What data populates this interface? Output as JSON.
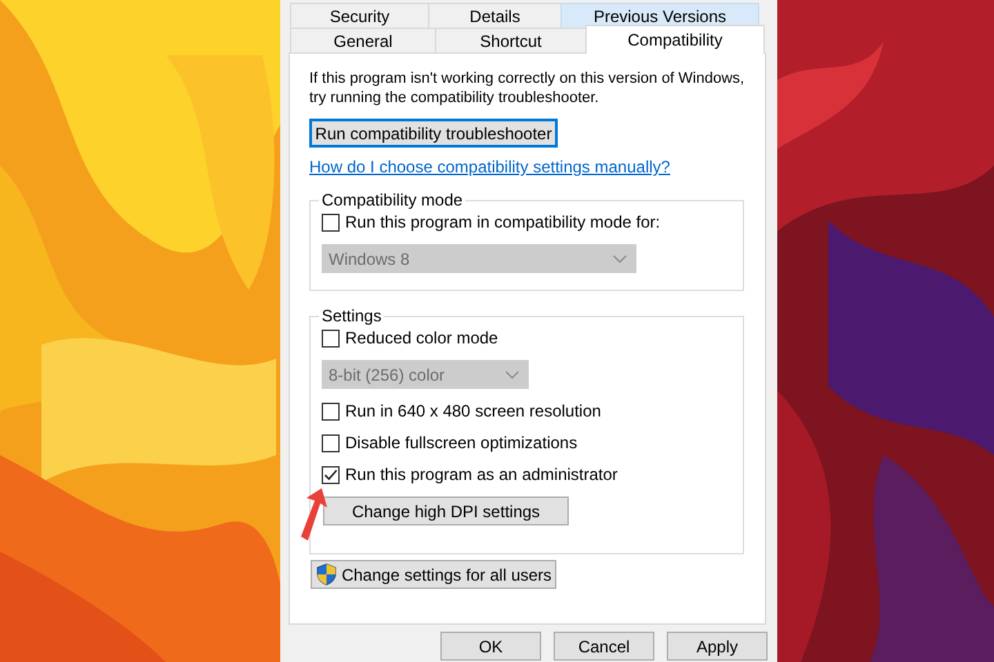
{
  "tab_rows": [
    {
      "tabs": [
        {
          "label": "Security",
          "selected": false,
          "hovered": false
        },
        {
          "label": "Details",
          "selected": false,
          "hovered": false
        },
        {
          "label": "Previous Versions",
          "selected": false,
          "hovered": true
        }
      ]
    },
    {
      "tabs": [
        {
          "label": "General",
          "selected": false,
          "hovered": false
        },
        {
          "label": "Shortcut",
          "selected": false,
          "hovered": false
        },
        {
          "label": "Compatibility",
          "selected": true,
          "hovered": false
        }
      ]
    }
  ],
  "intro": [
    "If this program isn't working correctly on this version of Windows,",
    "try running the compatibility troubleshooter."
  ],
  "troubleshoot_button": {
    "label": "Run compatibility troubleshooter",
    "focused": true
  },
  "help_link": "How do I choose compatibility settings manually?",
  "groups": [
    {
      "title": "Compatibility mode",
      "items": [
        {
          "kind": "checkbox",
          "label": "Run this program in compatibility mode for:",
          "checked": false
        },
        {
          "kind": "dropdown",
          "value": "Windows 8",
          "disabled": true
        }
      ]
    },
    {
      "title": "Settings",
      "items": [
        {
          "kind": "checkbox",
          "label": "Reduced color mode",
          "checked": false
        },
        {
          "kind": "dropdown",
          "value": "8-bit (256) color",
          "disabled": true
        },
        {
          "kind": "checkbox",
          "label": "Run in 640 x 480 screen resolution",
          "checked": false
        },
        {
          "kind": "checkbox",
          "label": "Disable fullscreen optimizations",
          "checked": false
        },
        {
          "kind": "checkbox",
          "label": "Run this program as an administrator",
          "checked": true
        },
        {
          "kind": "button",
          "label": "Change high DPI settings"
        }
      ]
    }
  ],
  "all_users_button": {
    "label": "Change settings for all users"
  },
  "footer_buttons": [
    {
      "label": "OK"
    },
    {
      "label": "Cancel"
    },
    {
      "label": "Apply"
    }
  ]
}
